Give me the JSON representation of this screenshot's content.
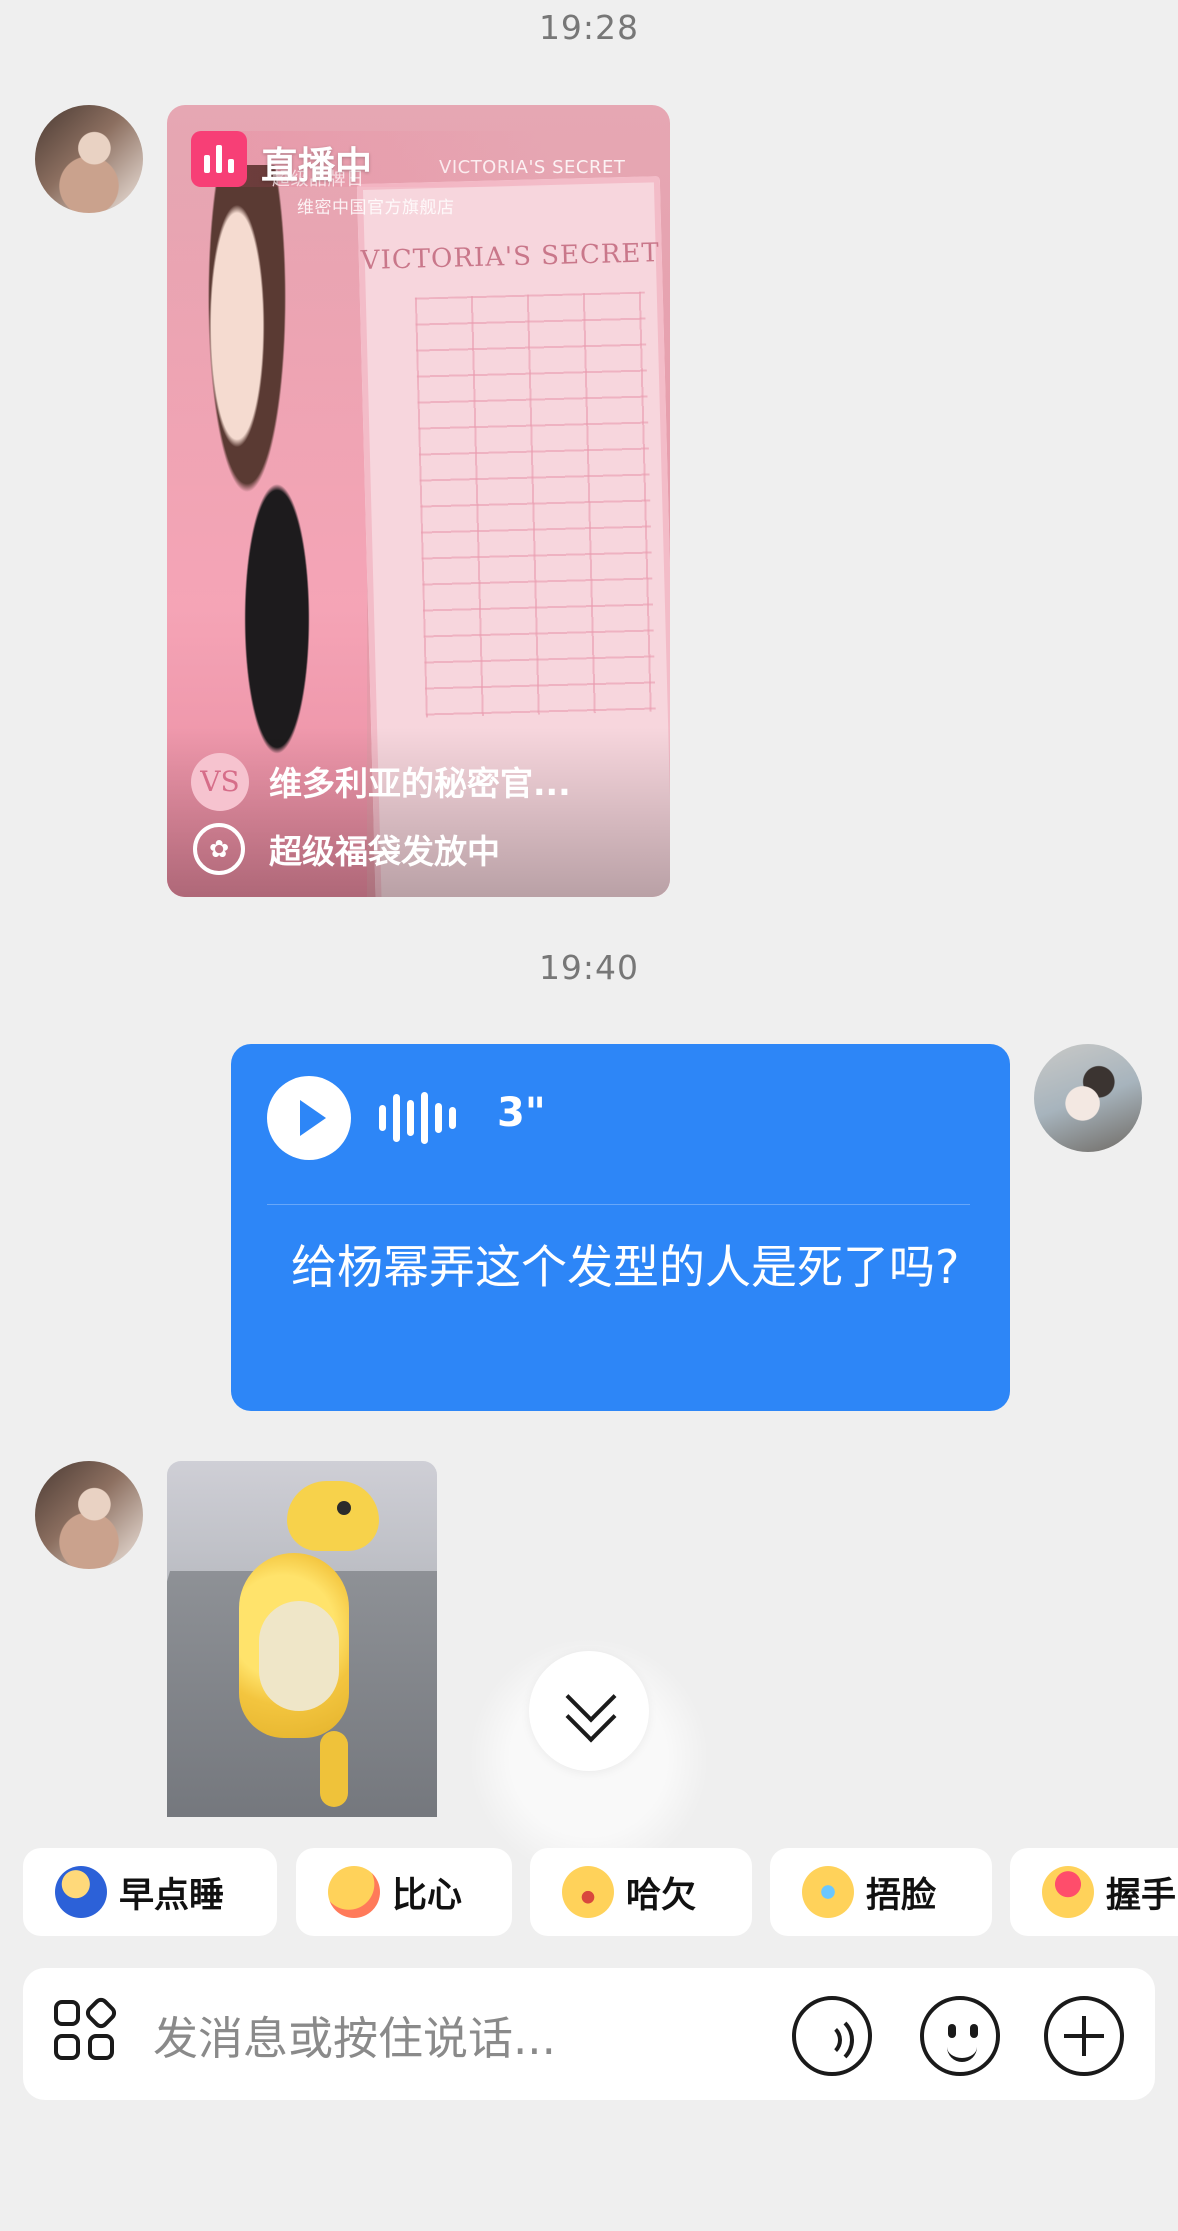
{
  "timestamps": [
    "19:28",
    "19:40"
  ],
  "live_card": {
    "badge": "直播中",
    "overlay_small_1": "超级品牌日",
    "overlay_small_2": "维密中国官方旗舰店",
    "overlay_brand": "VICTORIA'S SECRET",
    "board_title": "VICTORIA'S SECRET",
    "shop_name": "维多利亚的秘密官...",
    "promo": "超级福袋发放中",
    "shop_logo_text": "VS"
  },
  "voice_message": {
    "duration": "3\"",
    "transcript": "给杨幂弄这个发型的人是死了吗?"
  },
  "quick_replies": [
    {
      "label": "早点睡",
      "emoji": "sleep"
    },
    {
      "label": "比心",
      "emoji": "heart"
    },
    {
      "label": "哈欠",
      "emoji": "yawn"
    },
    {
      "label": "捂脸",
      "emoji": "facepalm"
    },
    {
      "label": "握手",
      "emoji": "handshake"
    }
  ],
  "input": {
    "placeholder": "发消息或按住说话..."
  },
  "icons": {
    "apps": "apps-grid-icon",
    "voice": "voice-input-icon",
    "emoji": "emoji-face-icon",
    "plus": "plus-icon",
    "scroll": "scroll-down-chevron-icon",
    "play": "play-icon",
    "waveform": "waveform-icon",
    "live": "live-bars-icon",
    "gift": "gift-bag-icon"
  },
  "colors": {
    "accent_blue": "#2d86f7",
    "live_pink": "#f73f76",
    "background": "#efefef"
  }
}
